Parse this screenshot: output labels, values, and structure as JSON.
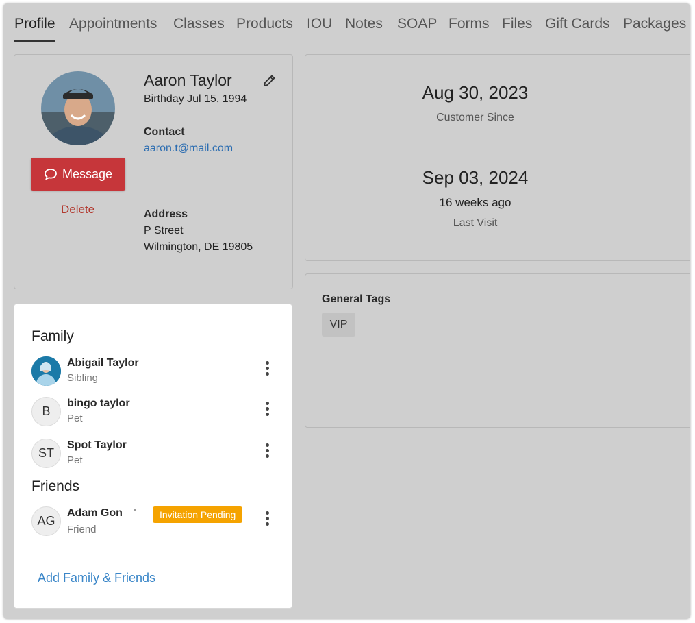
{
  "tabs": [
    {
      "label": "Profile",
      "active": true
    },
    {
      "label": "Appointments"
    },
    {
      "label": "Classes"
    },
    {
      "label": "Products"
    },
    {
      "label": "IOU"
    },
    {
      "label": "Notes"
    },
    {
      "label": "SOAP"
    },
    {
      "label": "Forms"
    },
    {
      "label": "Files"
    },
    {
      "label": "Gift Cards"
    },
    {
      "label": "Packages"
    }
  ],
  "profile": {
    "name": "Aaron Taylor",
    "birthday": "Birthday Jul 15, 1994",
    "contact_label": "Contact",
    "email": "aaron.t@mail.com",
    "address_label": "Address",
    "address_line1": "P Street",
    "address_line2": "Wilmington, DE 19805",
    "message_button": "Message",
    "delete_link": "Delete",
    "icons": {
      "edit": "pencil-icon",
      "message": "chat-bubble-icon"
    }
  },
  "stats": {
    "customer_since_date": "Aug 30, 2023",
    "customer_since_label": "Customer Since",
    "last_visit_date": "Sep 03, 2024",
    "last_visit_relative": "16 weeks ago",
    "last_visit_label": "Last Visit"
  },
  "tags": {
    "title": "General Tags",
    "items": [
      "VIP"
    ]
  },
  "family": {
    "family_title": "Family",
    "friends_title": "Friends",
    "members": [
      {
        "initials": "",
        "name": "Abigail Taylor",
        "relation": "Sibling"
      },
      {
        "initials": "B",
        "name": "bingo taylor",
        "relation": "Pet"
      },
      {
        "initials": "ST",
        "name": "Spot Taylor",
        "relation": "Pet"
      }
    ],
    "friends": [
      {
        "initials": "AG",
        "name": "Adam Gon",
        "relation": "Friend",
        "badge": "Invitation Pending"
      }
    ],
    "add_link": "Add Family & Friends"
  },
  "colors": {
    "message_button": "#c6363a",
    "delete_link": "#b23a30",
    "email_link": "#2c6db1",
    "pending_badge": "#f5a300",
    "add_link": "#3a86c8"
  }
}
